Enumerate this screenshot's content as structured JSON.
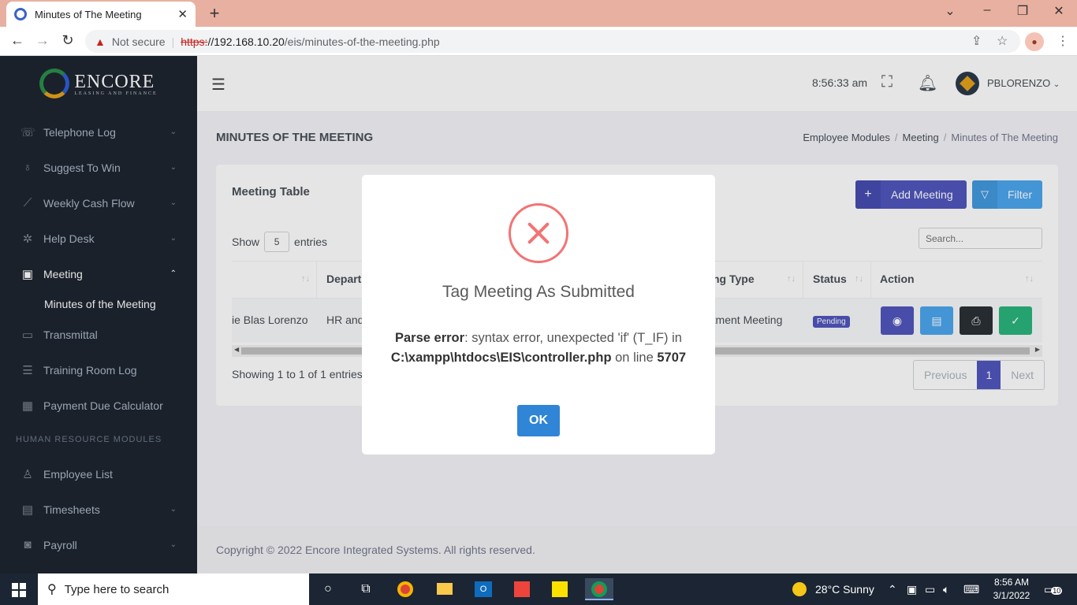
{
  "browser": {
    "tab_title": "Minutes of The Meeting",
    "not_secure": "Not secure",
    "url_proto": "https:",
    "url_host": "//192.168.10.20",
    "url_path": "/eis/minutes-of-the-meeting.php"
  },
  "sidebar": {
    "brand": "ENCORE",
    "brand_sub": "LEASING AND FINANCE",
    "items": [
      {
        "label": "Telephone Log",
        "icon": "phone-icon"
      },
      {
        "label": "Suggest To Win",
        "icon": "lightbulb-icon"
      },
      {
        "label": "Weekly Cash Flow",
        "icon": "chart-line-icon"
      },
      {
        "label": "Help Desk",
        "icon": "bug-icon"
      },
      {
        "label": "Meeting",
        "icon": "book-icon"
      }
    ],
    "sub_item": "Minutes of the Meeting",
    "items2": [
      {
        "label": "Transmittal",
        "icon": "inbox-icon"
      },
      {
        "label": "Training Room Log",
        "icon": "clipboard-icon"
      },
      {
        "label": "Payment Due Calculator",
        "icon": "calculator-icon"
      }
    ],
    "section_title": "HUMAN RESOURCE MODULES",
    "items3": [
      {
        "label": "Employee List",
        "icon": "user-icon"
      },
      {
        "label": "Timesheets",
        "icon": "calendar-icon"
      },
      {
        "label": "Payroll",
        "icon": "cash-icon"
      }
    ]
  },
  "topbar": {
    "time": "8:56:33 am",
    "username": "PBLORENZO"
  },
  "page": {
    "title": "MINUTES OF THE MEETING",
    "breadcrumb": [
      "Employee Modules",
      "Meeting",
      "Minutes of The Meeting"
    ]
  },
  "card": {
    "title": "Meeting Table",
    "add_button": "Add Meeting",
    "filter_button": "Filter",
    "show_label": "Show",
    "show_value": "5",
    "entries_label": "entries",
    "search_placeholder": "Search...",
    "columns": [
      "Depart",
      "ng Type",
      "Status",
      "Action"
    ],
    "row": {
      "name": "ie Blas Lorenzo",
      "department": "HR and",
      "type": "rtment Meeting",
      "status": "Pending"
    },
    "info": "Showing 1 to 1 of 1 entries",
    "pager": {
      "prev": "Previous",
      "page": "1",
      "next": "Next"
    }
  },
  "footer": {
    "text": "Copyright © 2022 Encore Integrated Systems. All rights reserved."
  },
  "modal": {
    "title": "Tag Meeting As Submitted",
    "err_label": "Parse error",
    "err_msg": ": syntax error, unexpected 'if' (T_IF) in ",
    "err_file": "C:\\xampp\\htdocs\\EIS\\controller.php",
    "err_on": " on line ",
    "err_line": "5707",
    "ok": "OK"
  },
  "taskbar": {
    "search_placeholder": "Type here to search",
    "weather": "28°C  Sunny",
    "time": "8:56 AM",
    "date": "3/1/2022",
    "notif_count": "10"
  },
  "colors": {
    "accent": "#5156be",
    "sidebar_bg": "#1f2530",
    "error": "#f27474",
    "ok_button": "#3085d6"
  }
}
